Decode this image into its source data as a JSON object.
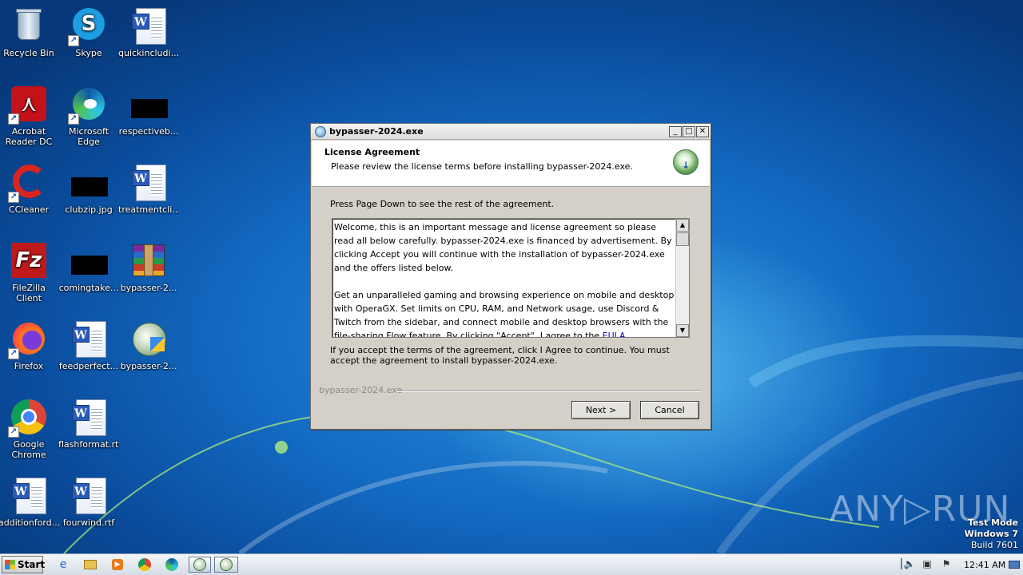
{
  "desktop": {
    "icons": [
      {
        "label": "Recycle Bin"
      },
      {
        "label": "Skype"
      },
      {
        "label": "quickincludi..."
      },
      {
        "label": "Acrobat Reader DC"
      },
      {
        "label": "Microsoft Edge"
      },
      {
        "label": "respectiveb..."
      },
      {
        "label": "CCleaner"
      },
      {
        "label": "clubzip.jpg"
      },
      {
        "label": "treatmentcli..."
      },
      {
        "label": "FileZilla Client"
      },
      {
        "label": "comingtake..."
      },
      {
        "label": "bypasser-2..."
      },
      {
        "label": "Firefox"
      },
      {
        "label": "feedperfect..."
      },
      {
        "label": "bypasser-2..."
      },
      {
        "label": "Google Chrome"
      },
      {
        "label": "flashformat.rtf"
      },
      {
        "label": "additionford..."
      },
      {
        "label": "fourwind.rtf"
      }
    ]
  },
  "dialog": {
    "title": "bypasser-2024.exe",
    "header_title": "License Agreement",
    "header_subtitle": "Please review the license terms before installing bypasser-2024.exe.",
    "press_text": "Press Page Down to see the rest of the agreement.",
    "license_p1": "Welcome, this is an important message and license agreement so please read all below carefully. bypasser-2024.exe is financed by advertisement. By clicking Accept you will continue with the installation of bypasser-2024.exe and the offers listed below.",
    "license_p2": "Get an unparalleled gaming and browsing experience on mobile and desktop with OperaGX. Set limits on CPU, RAM, and Network usage, use Discord & Twitch from the sidebar, and connect mobile and desktop browsers with the file-sharing Flow feature. By clicking \"Accept\", I agree to the",
    "license_link": "EULA",
    "accept_text": "If you accept the terms of the agreement, click I Agree to continue. You must accept the agreement to install bypasser-2024.exe.",
    "brand": "bypasser-2024.exe",
    "next_label": "Next >",
    "cancel_label": "Cancel",
    "min_label": "_",
    "max_label": "□",
    "close_label": "✕"
  },
  "watermark": {
    "text": "ANY▷RUN",
    "mode": "Test Mode",
    "os": "Windows 7",
    "build": "Build 7601"
  },
  "taskbar": {
    "start_label": "Start",
    "clock": "12:41 AM"
  }
}
